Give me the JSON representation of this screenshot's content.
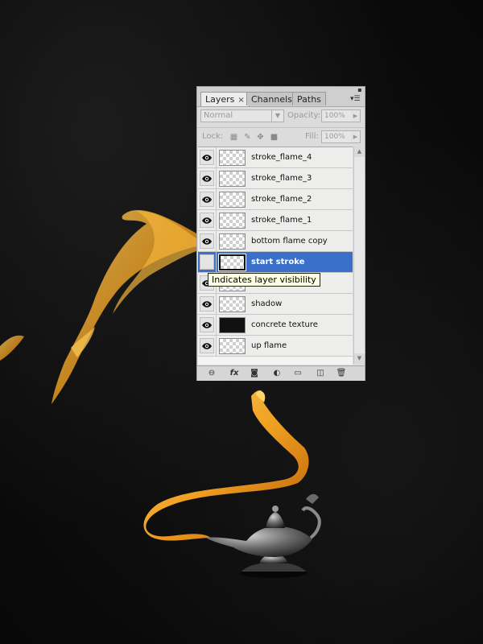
{
  "palette": {
    "tabs": [
      {
        "label": "Layers",
        "close": "×",
        "active": true
      },
      {
        "label": "Channels",
        "active": false
      },
      {
        "label": "Paths",
        "active": false
      }
    ],
    "blend_mode": "Normal",
    "opacity_label": "Opacity:",
    "opacity_value": "100%",
    "lock_label": "Lock:",
    "fill_label": "Fill:",
    "fill_value": "100%",
    "layers": [
      {
        "name": "stroke_flame_4",
        "visible": true,
        "thumb": "transparent",
        "selected": false
      },
      {
        "name": "stroke_flame_3",
        "visible": true,
        "thumb": "transparent",
        "selected": false
      },
      {
        "name": "stroke_flame_2",
        "visible": true,
        "thumb": "transparent",
        "selected": false
      },
      {
        "name": "stroke_flame_1",
        "visible": true,
        "thumb": "transparent",
        "selected": false
      },
      {
        "name": "bottom flame copy",
        "visible": true,
        "thumb": "transparent",
        "selected": false
      },
      {
        "name": "start stroke",
        "visible": false,
        "thumb": "transparent",
        "selected": true
      },
      {
        "name": "",
        "visible": true,
        "thumb": "transparent",
        "selected": false
      },
      {
        "name": "shadow",
        "visible": true,
        "thumb": "transparent",
        "selected": false
      },
      {
        "name": "concrete texture",
        "visible": true,
        "thumb": "dark",
        "selected": false
      },
      {
        "name": "up flame",
        "visible": true,
        "thumb": "transparent",
        "selected": false
      }
    ],
    "bottom_icons": [
      "link-icon",
      "fx-icon",
      "mask-icon",
      "adjustment-icon",
      "folder-icon",
      "new-layer-icon",
      "trash-icon"
    ],
    "fx_label": "fx"
  },
  "tooltip": "Indicates layer visibility",
  "colors": {
    "selection": "#3a6fca",
    "flame": "#f0a020",
    "tooltip_bg": "#ffffe1"
  }
}
